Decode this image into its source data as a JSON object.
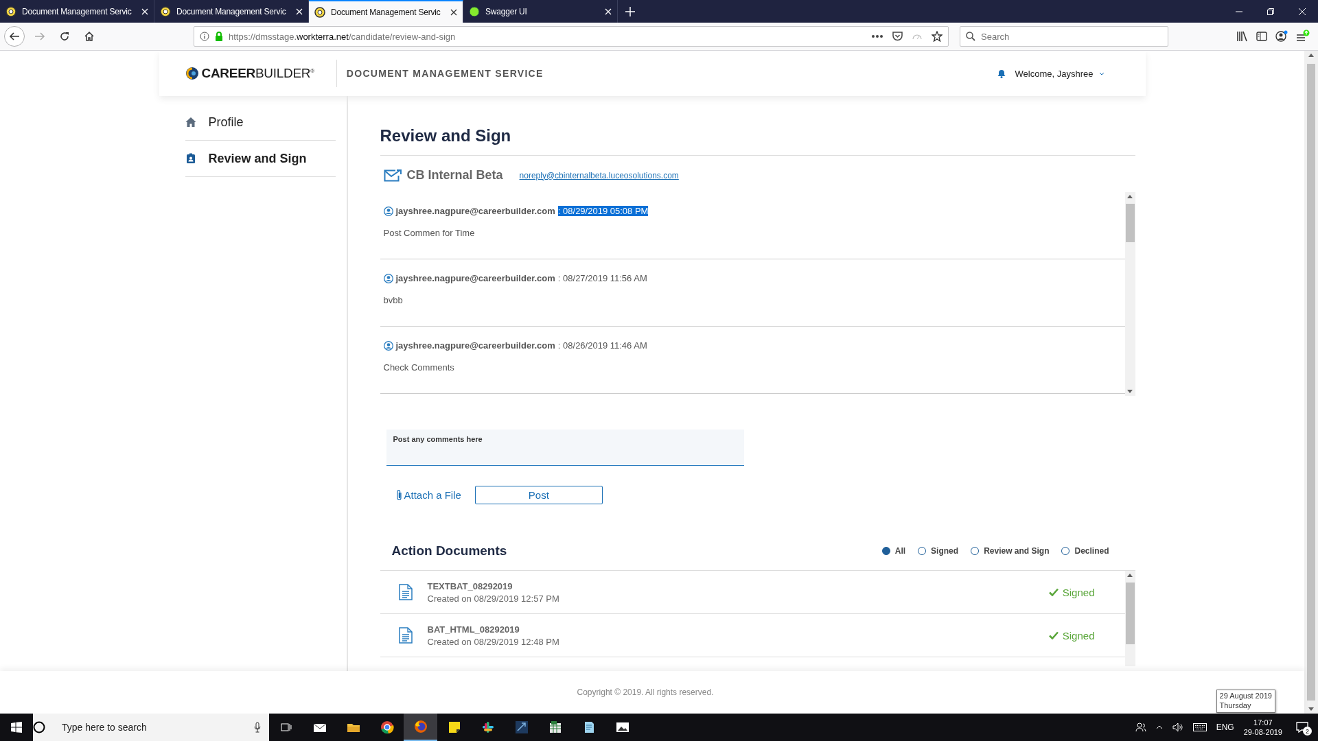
{
  "browser": {
    "tabs": [
      {
        "title": "Document Management Servic",
        "selected": false
      },
      {
        "title": "Document Management Servic",
        "selected": false
      },
      {
        "title": "Document Management Servic",
        "selected": true
      },
      {
        "title": "Swagger UI",
        "selected": false
      }
    ],
    "url": {
      "scheme_host": "https://dmsstage.",
      "domain": "workterra.net",
      "path": "/candidate/review-and-sign"
    },
    "search": {
      "placeholder": "Search"
    }
  },
  "header": {
    "logo": "**CAREER**BUILDER$^{®}$",
    "service_title": "DOCUMENT MANAGEMENT SERVICE",
    "welcome": "Welcome, Jayshree"
  },
  "sidebar": {
    "items": [
      {
        "label": "Profile",
        "selected": false
      },
      {
        "label": "Review and Sign",
        "selected": true
      }
    ]
  },
  "main": {
    "title": "Review and Sign",
    "sender": {
      "name": "CB Internal Beta",
      "email": "noreply@cbinternalbeta.luceosolutions.com"
    },
    "comments": [
      {
        "author": "jayshree.nagpure@careerbuilder.com",
        "time": ": 08/29/2019 05:08 PM",
        "highlighted": true,
        "text": "Post Commen for Time"
      },
      {
        "author": "jayshree.nagpure@careerbuilder.com",
        "time": ": 08/27/2019 11:56 AM",
        "highlighted": false,
        "text": "bvbb"
      },
      {
        "author": "jayshree.nagpure@careerbuilder.com",
        "time": ": 08/26/2019 11:46 AM",
        "highlighted": false,
        "text": "Check Comments"
      }
    ],
    "comment_box": {
      "placeholder": "Post any comments here"
    },
    "attach": "Attach a File",
    "post": "Post"
  },
  "action_documents": {
    "title": "Action Documents",
    "filters": [
      {
        "label": "All",
        "selected": true
      },
      {
        "label": "Signed",
        "selected": false
      },
      {
        "label": "Review and Sign",
        "selected": false
      },
      {
        "label": "Declined",
        "selected": false
      }
    ],
    "documents": [
      {
        "name": "TEXTBAT_08292019",
        "created": "Created on 08/29/2019 12:57 PM",
        "status": "Signed"
      },
      {
        "name": "BAT_HTML_08292019",
        "created": "Created on 08/29/2019 12:48 PM",
        "status": "Signed"
      }
    ]
  },
  "footer": {
    "copyright": "Copyright © 2019. All rights reserved."
  },
  "date_tooltip": {
    "lines": [
      "29 August 2019",
      "Thursday"
    ]
  },
  "taskbar": {
    "search_placeholder": "Type here to search",
    "apps": [
      {
        "active": false
      },
      {
        "active": false
      },
      {
        "active": false
      },
      {
        "active": false
      },
      {
        "active": true
      },
      {
        "active": false
      },
      {
        "active": false
      },
      {
        "active": false
      },
      {
        "active": false
      },
      {
        "active": false
      },
      {
        "active": false
      }
    ],
    "language": "ENG",
    "time": "17:07",
    "date": "29-08-2019",
    "notifications": "2"
  }
}
